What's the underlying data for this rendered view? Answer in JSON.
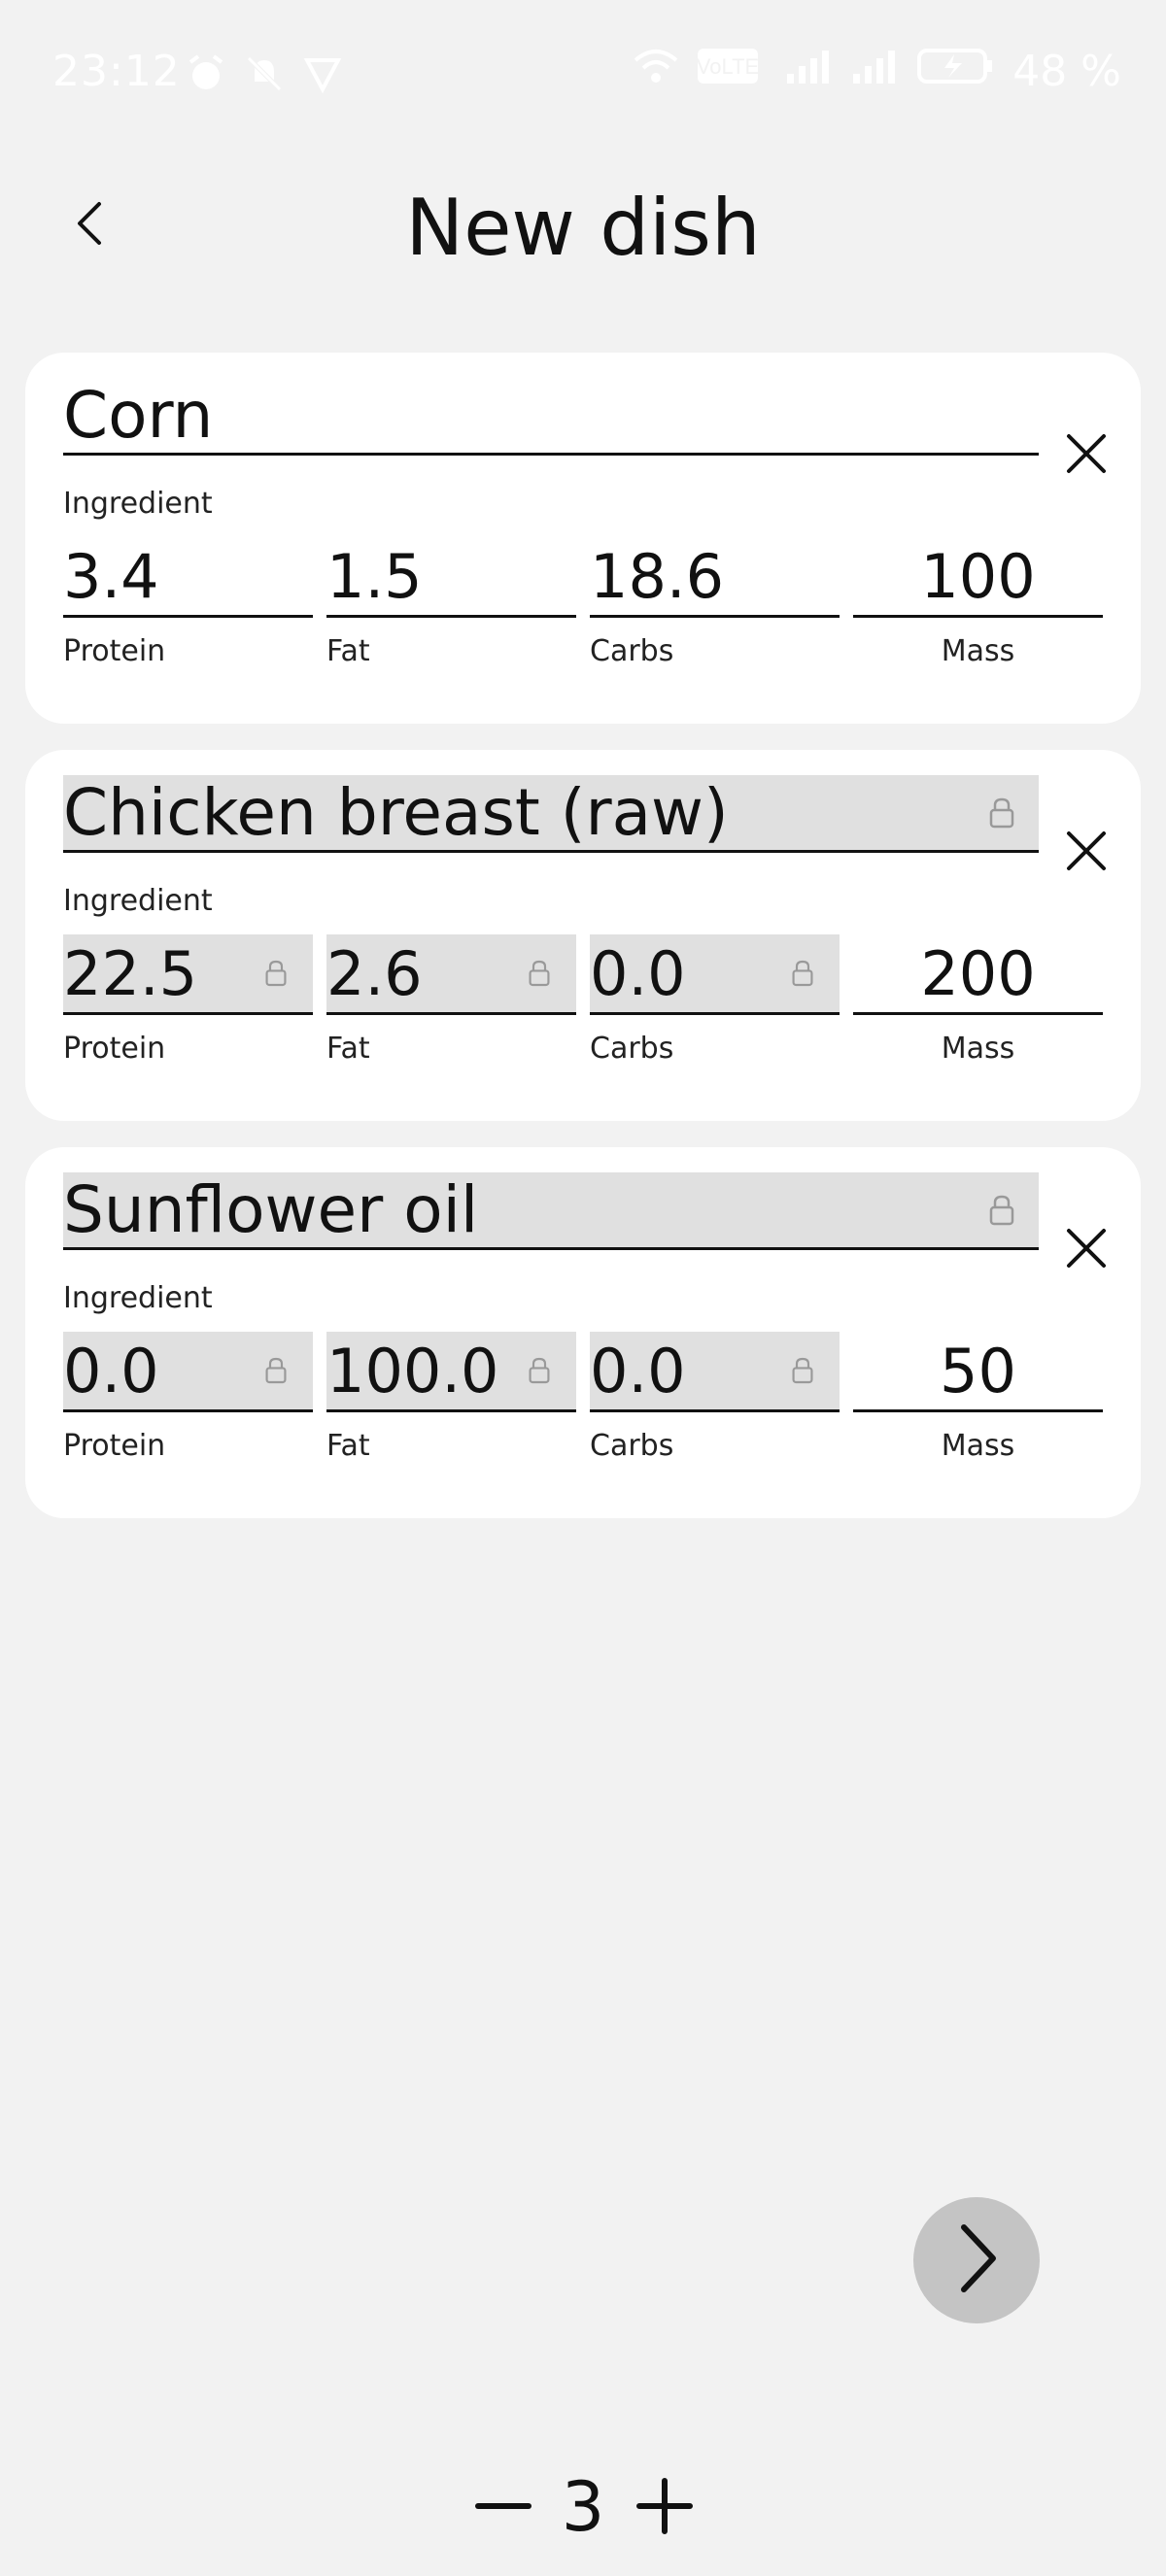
{
  "status_bar": {
    "time": "23:12",
    "battery": "48 %",
    "icons_left": [
      "alarm-icon",
      "mute-icon",
      "vpn-icon"
    ],
    "icons_right": [
      "wifi-icon",
      "volte-icon",
      "signal-icon",
      "signal-icon",
      "battery-charging-icon"
    ],
    "volte_label": "VoLTE"
  },
  "header": {
    "title": "New dish",
    "back_icon": "chevron-left-icon"
  },
  "labels": {
    "ingredient": "Ingredient",
    "protein": "Protein",
    "fat": "Fat",
    "carbs": "Carbs",
    "mass": "Mass"
  },
  "ingredients": [
    {
      "name": "Corn",
      "locked": false,
      "protein": "3.4",
      "fat": "1.5",
      "carbs": "18.6",
      "mass": "100"
    },
    {
      "name": "Chicken breast (raw)",
      "locked": true,
      "protein": "22.5",
      "fat": "2.6",
      "carbs": "0.0",
      "mass": "200"
    },
    {
      "name": "Sunflower oil",
      "locked": true,
      "protein": "0.0",
      "fat": "100.0",
      "carbs": "0.0",
      "mass": "50"
    }
  ],
  "counter": {
    "value": "3"
  },
  "colors": {
    "background": "#f2f2f2",
    "card": "#ffffff",
    "locked_field": "#e0e0e0",
    "next_button": "#c4c4c4",
    "text": "#111111"
  }
}
